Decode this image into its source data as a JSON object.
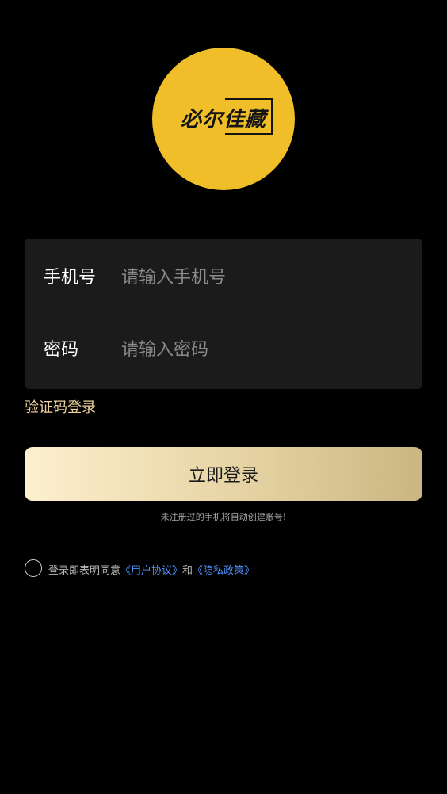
{
  "logo": {
    "text": "必尔佳藏",
    "color": "#f0be29"
  },
  "form": {
    "phone": {
      "label": "手机号",
      "placeholder": "请输入手机号",
      "value": ""
    },
    "password": {
      "label": "密码",
      "placeholder": "请输入密码",
      "value": ""
    }
  },
  "sms_login_label": "验证码登录",
  "login_button_label": "立即登录",
  "hint": "未注册过的手机将自动创建账号!",
  "agreement": {
    "prefix": "登录即表明同意",
    "user_agreement": "《用户协议》",
    "conjunction": "和",
    "privacy_policy": "《隐私政策》",
    "checked": false
  },
  "colors": {
    "background": "#000000",
    "card": "#1b1b1b",
    "accent_gold": "#f0d39a",
    "link_blue": "#4f8ff7"
  }
}
